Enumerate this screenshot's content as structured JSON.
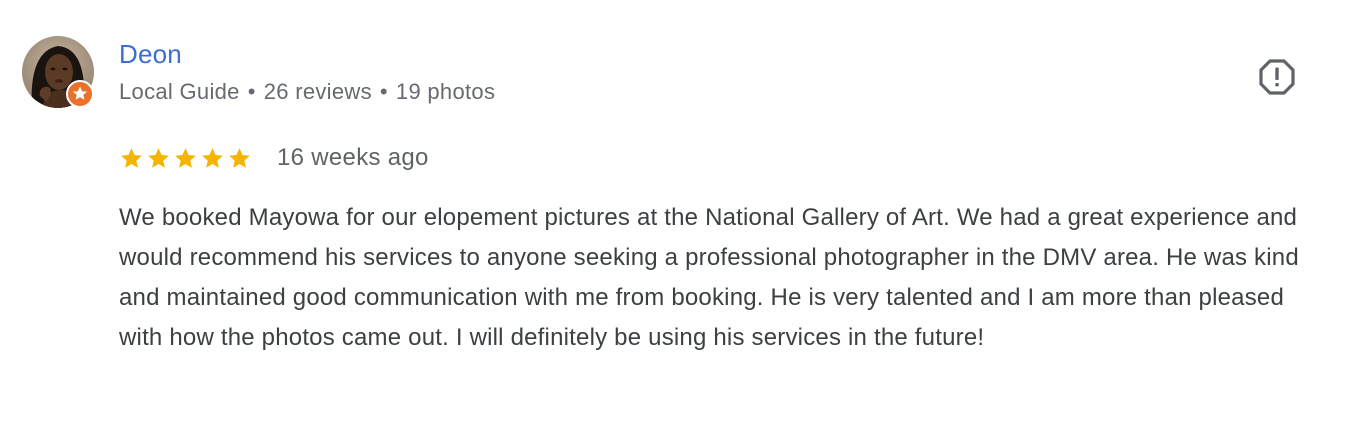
{
  "review": {
    "author": {
      "name": "Deon",
      "badge": "Local Guide",
      "reviews": "26 reviews",
      "photos": "19 photos",
      "separator": "•",
      "avatar_icon": "user-photo",
      "badge_icon": "local-guide-star-icon"
    },
    "flag_icon": "report-flag-icon",
    "rating": 5,
    "rating_max": 5,
    "date": "16 weeks ago",
    "text": "We booked Mayowa for our elopement pictures at the National Gallery of Art. We had a great experience and would recommend his services to anyone seeking a professional photographer in the DMV area. He was kind and maintained good communication with me from booking. He is very talented and I am more than pleased with how the photos came out. I will definitely be using his services in the future!"
  },
  "colors": {
    "name": "#3b6ed0",
    "meta": "#666a70",
    "star": "#f4b400",
    "text": "#3c4043",
    "badge": "#e8712c"
  }
}
